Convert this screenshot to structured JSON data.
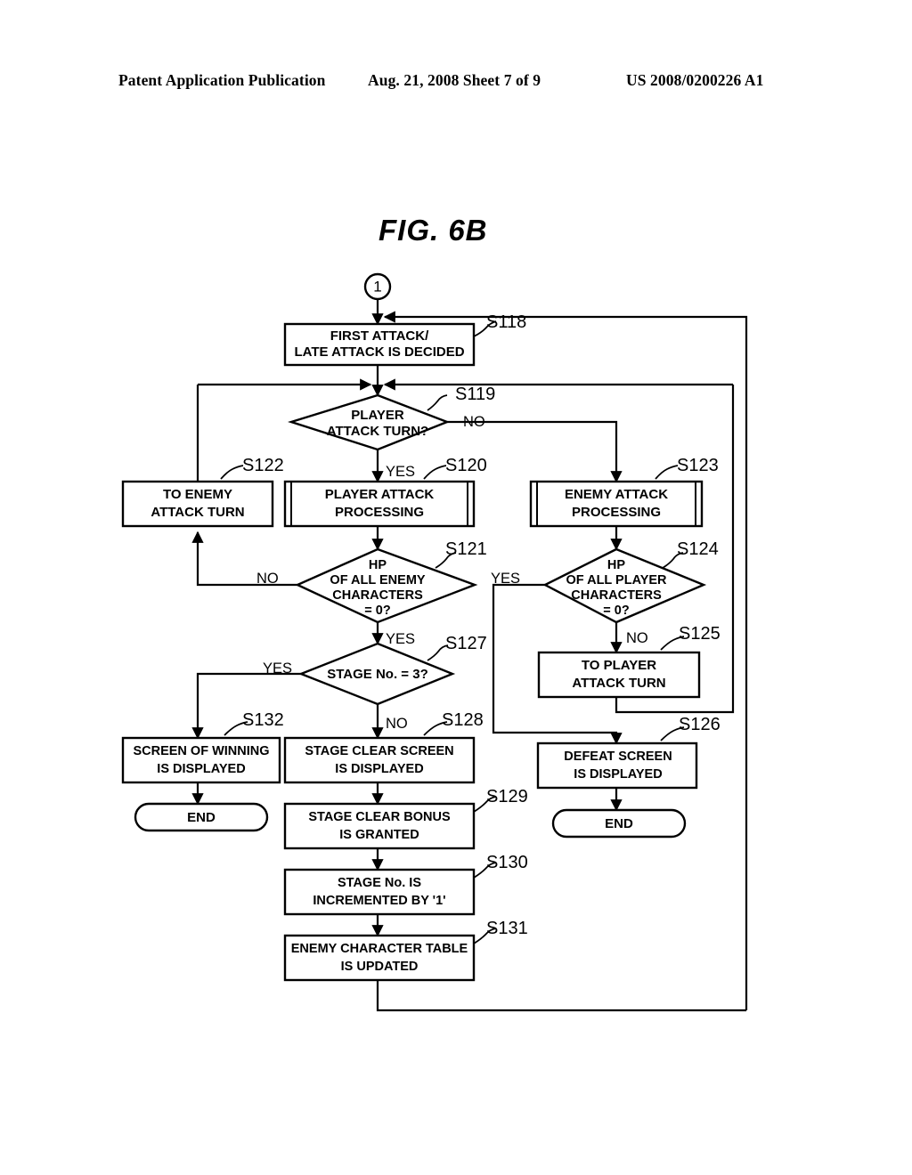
{
  "header": {
    "left": "Patent Application Publication",
    "middle": "Aug. 21, 2008  Sheet 7 of 9",
    "right": "US 2008/0200226 A1"
  },
  "figure": {
    "title": "FIG.  6B",
    "entry_connector": "1"
  },
  "nodes": {
    "s118": {
      "tag": "S118",
      "line1": "FIRST ATTACK/",
      "line2": "LATE ATTACK IS DECIDED"
    },
    "s119": {
      "tag": "S119",
      "line1": "PLAYER",
      "line2": "ATTACK TURN?",
      "yes": "YES",
      "no": "NO"
    },
    "s122": {
      "tag": "S122",
      "line1": "TO ENEMY",
      "line2": "ATTACK TURN"
    },
    "s120": {
      "tag": "S120",
      "line1": "PLAYER ATTACK",
      "line2": "PROCESSING"
    },
    "s123": {
      "tag": "S123",
      "line1": "ENEMY ATTACK",
      "line2": "PROCESSING"
    },
    "s121": {
      "tag": "S121",
      "line1": "HP",
      "line2": "OF ALL ENEMY",
      "line3": "CHARACTERS",
      "line4": "= 0?",
      "yes": "YES",
      "no": "NO"
    },
    "s124": {
      "tag": "S124",
      "line1": "HP",
      "line2": "OF ALL PLAYER",
      "line3": "CHARACTERS",
      "line4": "= 0?",
      "yes": "YES",
      "no": "NO"
    },
    "s125": {
      "tag": "S125",
      "line1": "TO PLAYER",
      "line2": "ATTACK TURN"
    },
    "s127": {
      "tag": "S127",
      "line1": "STAGE No. = 3?",
      "yes": "YES",
      "no": "NO"
    },
    "s132": {
      "tag": "S132",
      "line1": "SCREEN OF WINNING",
      "line2": "IS DISPLAYED"
    },
    "s128": {
      "tag": "S128",
      "line1": "STAGE CLEAR SCREEN",
      "line2": "IS DISPLAYED"
    },
    "s126": {
      "tag": "S126",
      "line1": "DEFEAT SCREEN",
      "line2": "IS DISPLAYED"
    },
    "s129": {
      "tag": "S129",
      "line1": "STAGE CLEAR BONUS",
      "line2": "IS GRANTED"
    },
    "s130": {
      "tag": "S130",
      "line1": "STAGE No. IS",
      "line2": "INCREMENTED BY '1'"
    },
    "s131": {
      "tag": "S131",
      "line1": "ENEMY CHARACTER TABLE",
      "line2": "IS UPDATED"
    },
    "end_left": {
      "label": "END"
    },
    "end_right": {
      "label": "END"
    }
  }
}
